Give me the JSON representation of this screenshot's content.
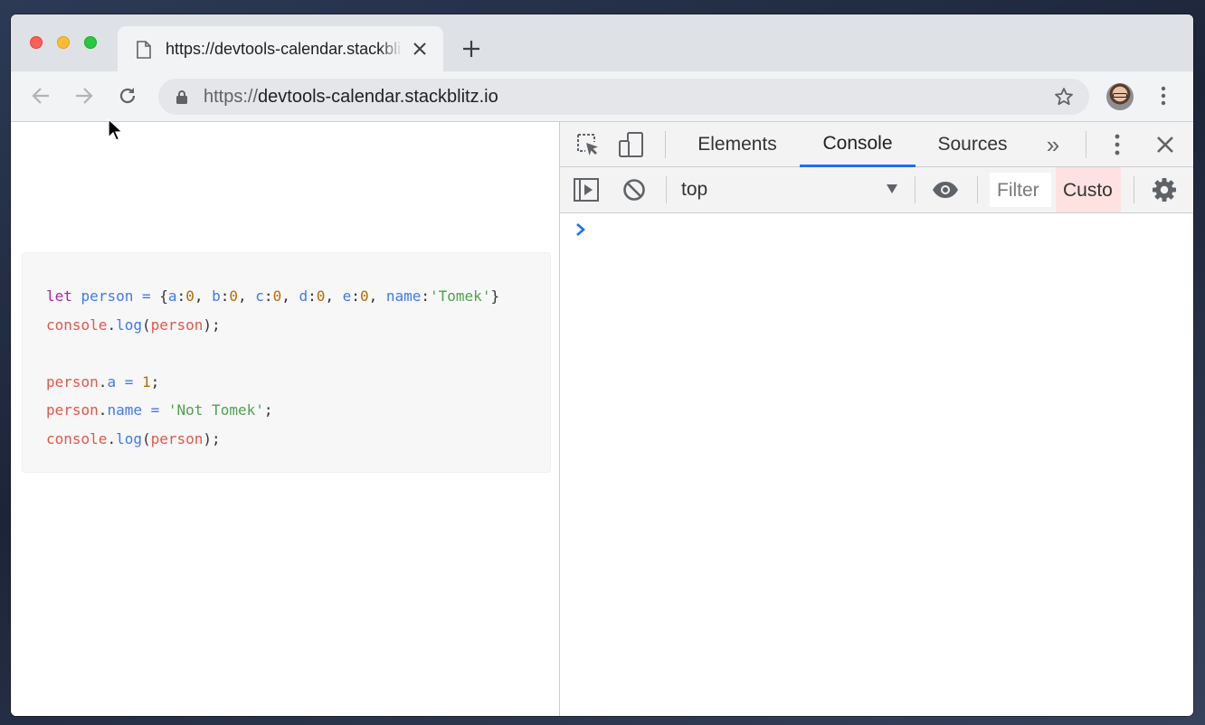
{
  "browser": {
    "tab": {
      "title": "https://devtools-calendar.stackblitz.io"
    },
    "address_bar": {
      "scheme": "https://",
      "host": "devtools-calendar.stackblitz.io"
    },
    "icons": {
      "back": "arrow-back-icon",
      "forward": "arrow-forward-icon",
      "reload": "reload-icon",
      "lock": "lock-icon",
      "bookmark": "star-icon",
      "menu": "more-vertical-icon",
      "new_tab": "plus-icon"
    }
  },
  "code_sample": {
    "line1": {
      "kw": "let",
      "var": "person",
      "op": "=",
      "open": "{",
      "k_a": "a",
      "v_a": "0",
      "k_b": "b",
      "v_b": "0",
      "k_c": "c",
      "v_c": "0",
      "k_d": "d",
      "v_d": "0",
      "k_e": "e",
      "v_e": "0",
      "k_name": "name",
      "v_name": "'Tomek'",
      "close": "}"
    },
    "line2": {
      "obj": "console",
      "fn": "log",
      "arg": "person",
      "end": ");"
    },
    "line4": {
      "obj": "person",
      "prop": "a",
      "op": "=",
      "val": "1",
      "end": ";"
    },
    "line5": {
      "obj": "person",
      "prop": "name",
      "op": "=",
      "val": "'Not Tomek'",
      "end": ";"
    },
    "line6": {
      "obj": "console",
      "fn": "log",
      "arg": "person",
      "end": ");"
    }
  },
  "devtools": {
    "tabs": [
      {
        "label": "Elements",
        "active": false
      },
      {
        "label": "Console",
        "active": true
      },
      {
        "label": "Sources",
        "active": false
      }
    ],
    "more_tabs": "»",
    "console_toolbar": {
      "context": "top",
      "filter_placeholder": "Filter",
      "levels_label": "Custo"
    },
    "prompt_symbol": "›",
    "colors": {
      "accent": "#1a73e8",
      "levels_bg": "#fde2e1"
    }
  }
}
